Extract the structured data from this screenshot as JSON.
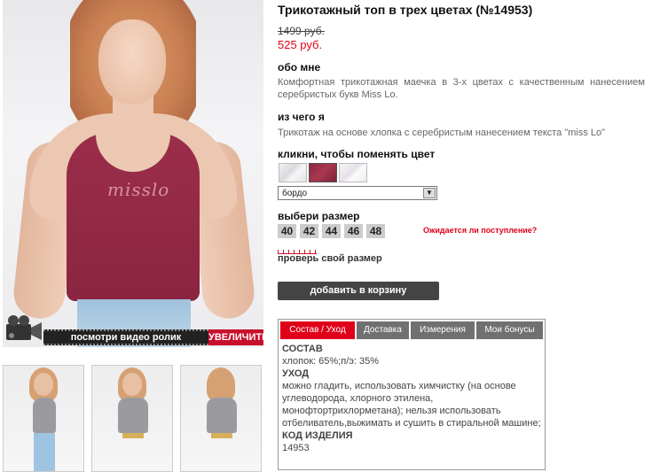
{
  "product": {
    "title": "Трикотажный топ в трех цветах (№14953)",
    "old_price": "1499 руб.",
    "new_price": "525 руб."
  },
  "about": {
    "heading": "обо мне",
    "text": "Комфортная трикотажная маечка в 3-х цветах с качественным нанесением серебристых букв Miss Lo."
  },
  "material": {
    "heading": "из чего я",
    "text": "Трикотаж на основе хлопка с серебристым нанесением текста \"miss Lo\""
  },
  "color": {
    "heading": "кликни, чтобы поменять цвет",
    "selected": "бордо",
    "swatches": [
      "#e6e6ea",
      "#962c47",
      "#efeaf0"
    ]
  },
  "size": {
    "heading": "выбери размер",
    "options": [
      "40",
      "42",
      "44",
      "46",
      "48"
    ],
    "awaiting_link": "Ожидается ли поступление?",
    "check_size": "проверь свой размер"
  },
  "image": {
    "print_text": "misslo",
    "video_label": "посмотри видео ролик",
    "zoom_label": "УВЕЛИЧИТЬ"
  },
  "cart": {
    "button": "добавить в корзину"
  },
  "tabs": {
    "items": [
      "Состав / Уход",
      "Доставка",
      "Измерения",
      "Мои бонусы"
    ],
    "active": "Состав / Уход",
    "content": {
      "composition_heading": "СОСТАВ",
      "composition": "хлопок: 65%;п/э: 35%",
      "care_heading": "УХОД",
      "care": "можно гладить, использовать химчистку (на основе углеводорода, хлорного этилена, монофтортрихлорметана); нельзя использовать отбеливатель,выжимать и сушить в стиральной машине;",
      "code_heading": "КОД ИЗДЕЛИЯ",
      "code": "14953"
    }
  },
  "colors": {
    "accent": "#e0001a",
    "cart_button": "#444444",
    "tab_inactive": "#707070"
  }
}
